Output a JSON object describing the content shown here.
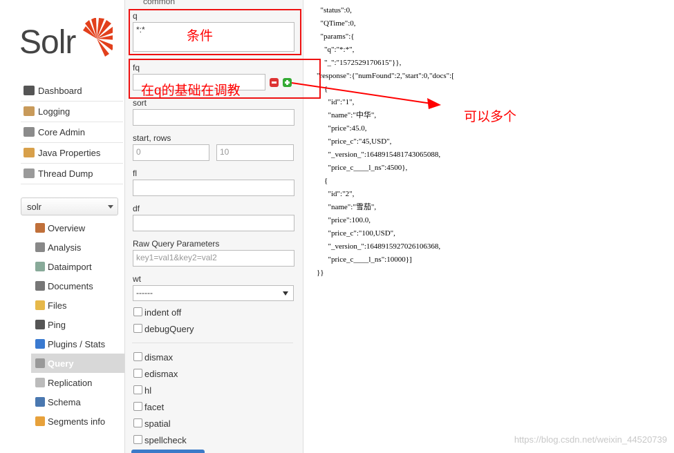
{
  "logo": {
    "text": "Solr"
  },
  "nav": [
    {
      "label": "Dashboard",
      "icon": "dashboard-icon",
      "color": "#555"
    },
    {
      "label": "Logging",
      "icon": "logging-icon",
      "color": "#c89a5a"
    },
    {
      "label": "Core Admin",
      "icon": "core-admin-icon",
      "color": "#8b8b8b"
    },
    {
      "label": "Java Properties",
      "icon": "java-properties-icon",
      "color": "#d8a04a"
    },
    {
      "label": "Thread Dump",
      "icon": "thread-dump-icon",
      "color": "#9a9a9a"
    }
  ],
  "core_selector": {
    "value": "solr"
  },
  "core_menu": [
    {
      "label": "Overview",
      "icon": "overview-icon",
      "color": "#c0703a"
    },
    {
      "label": "Analysis",
      "icon": "analysis-icon",
      "color": "#888"
    },
    {
      "label": "Dataimport",
      "icon": "dataimport-icon",
      "color": "#8a9"
    },
    {
      "label": "Documents",
      "icon": "documents-icon",
      "color": "#777"
    },
    {
      "label": "Files",
      "icon": "files-icon",
      "color": "#e6b84a"
    },
    {
      "label": "Ping",
      "icon": "ping-icon",
      "color": "#555"
    },
    {
      "label": "Plugins / Stats",
      "icon": "plugins-icon",
      "color": "#3a7ad0"
    },
    {
      "label": "Query",
      "icon": "query-icon",
      "color": "#999",
      "active": true
    },
    {
      "label": "Replication",
      "icon": "replication-icon",
      "color": "#bbb"
    },
    {
      "label": "Schema",
      "icon": "schema-icon",
      "color": "#4a78b0"
    },
    {
      "label": "Segments info",
      "icon": "segments-icon",
      "color": "#e7a13b"
    }
  ],
  "form": {
    "common_label": "common",
    "q_label": "q",
    "q_value": "*:*",
    "fq_label": "fq",
    "sort_label": "sort",
    "start_rows_label": "start, rows",
    "start_value": "0",
    "rows_value": "10",
    "fl_label": "fl",
    "df_label": "df",
    "raw_label": "Raw Query Parameters",
    "raw_placeholder": "key1=val1&key2=val2",
    "wt_label": "wt",
    "wt_value": "------",
    "indent_label": "indent off",
    "debug_label": "debugQuery",
    "dismax_label": "dismax",
    "edismax_label": "edismax",
    "hl_label": "hl",
    "facet_label": "facet",
    "spatial_label": "spatial",
    "spellcheck_label": "spellcheck"
  },
  "json_lines": [
    "  \"status\":0,",
    "  \"QTime\":0,",
    "  \"params\":{",
    "    \"q\":\"*:*\",",
    "    \"_\":\"1572529170615\"}},",
    "\"response\":{\"numFound\":2,\"start\":0,\"docs\":[",
    "    {",
    "      \"id\":\"1\",",
    "      \"name\":\"中华\",",
    "      \"price\":45.0,",
    "      \"price_c\":\"45,USD\",",
    "      \"_version_\":1648915481743065088,",
    "      \"price_c____l_ns\":4500},",
    "    {",
    "      \"id\":\"2\",",
    "      \"name\":\"雪茄\",",
    "      \"price\":100.0,",
    "      \"price_c\":\"100,USD\",",
    "      \"_version_\":1648915927026106368,",
    "      \"price_c____l_ns\":10000}]",
    "}}"
  ],
  "annotations": {
    "q_note": "条件",
    "fq_note": "在q的基础在调教",
    "multi_note": "可以多个",
    "color": "#ff0000"
  },
  "watermark": "https://blog.csdn.net/weixin_44520739"
}
